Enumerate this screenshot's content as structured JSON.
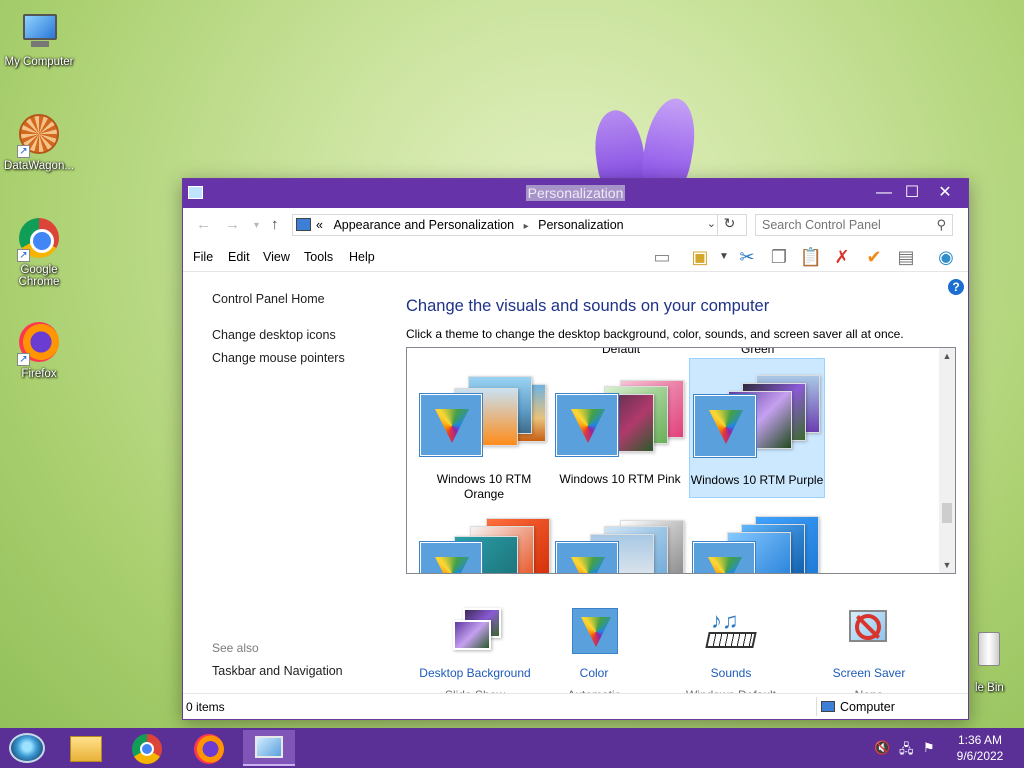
{
  "desktop": {
    "icons": [
      {
        "label": "My Computer"
      },
      {
        "label": "DataWagon..."
      },
      {
        "label": "Google Chrome"
      },
      {
        "label": "Firefox"
      }
    ],
    "recycle_bin_label": "le Bin"
  },
  "window": {
    "title": "Personalization",
    "controls": {
      "minimize": "—",
      "maximize": "☐",
      "close": "✕"
    },
    "nav": {
      "back": "←",
      "forward": "→",
      "recent": "▾",
      "up": "↑"
    },
    "address": {
      "prefix": "«",
      "crumbs": [
        "Appearance and Personalization",
        "Personalization"
      ],
      "separator": "▸"
    },
    "search": {
      "placeholder": "Search Control Panel"
    },
    "menu": [
      "File",
      "Edit",
      "View",
      "Tools",
      "Help"
    ],
    "toolbar_icons": [
      "layout-icon",
      "properties-icon",
      "dropdown-arrow-icon",
      "cut-icon",
      "copy-icon",
      "paste-icon",
      "delete-icon",
      "check-icon",
      "rename-icon",
      "globe-icon"
    ],
    "sidebar": {
      "home": "Control Panel Home",
      "links": [
        "Change desktop icons",
        "Change mouse pointers"
      ],
      "see_also_heading": "See also",
      "see_also_links": [
        "Taskbar and Navigation"
      ]
    },
    "main": {
      "heading": "Change the visuals and sounds on your computer",
      "description": "Click a theme to change the desktop background, color, sounds, and screen saver all at once.",
      "cut_labels": [
        "Default",
        "Green"
      ],
      "themes": [
        {
          "name": "Windows 10 RTM Orange",
          "selected": false,
          "accent": "#ff8c1a"
        },
        {
          "name": "Windows 10 RTM Pink",
          "selected": false,
          "accent": "#e0407a"
        },
        {
          "name": "Windows 10 RTM Purple",
          "selected": true,
          "accent": "#7a3fc8"
        },
        {
          "name": "",
          "selected": false,
          "accent": "#e84e1b"
        },
        {
          "name": "",
          "selected": false,
          "accent": "#6aa7d8"
        },
        {
          "name": "",
          "selected": false,
          "accent": "#1f7bd6"
        }
      ],
      "settings": [
        {
          "label": "Desktop Background",
          "value": "Slide Show"
        },
        {
          "label": "Color",
          "value": "Automatic"
        },
        {
          "label": "Sounds",
          "value": "Windows Default"
        },
        {
          "label": "Screen Saver",
          "value": "None"
        }
      ]
    },
    "status": {
      "items": "0 items",
      "location": "Computer"
    }
  },
  "taskbar": {
    "apps": [
      "file-explorer-icon",
      "chrome-icon",
      "firefox-icon",
      "control-panel-icon"
    ],
    "active_app": "control-panel-icon",
    "tray_icons": [
      "volume-muted-icon",
      "network-icon",
      "action-center-icon"
    ],
    "time": "1:36 AM",
    "date": "9/6/2022"
  },
  "colors": {
    "titlebar": "#6633a8",
    "taskbar": "#5a2f96",
    "link": "#1e5bb8",
    "heading": "#1e3287"
  }
}
